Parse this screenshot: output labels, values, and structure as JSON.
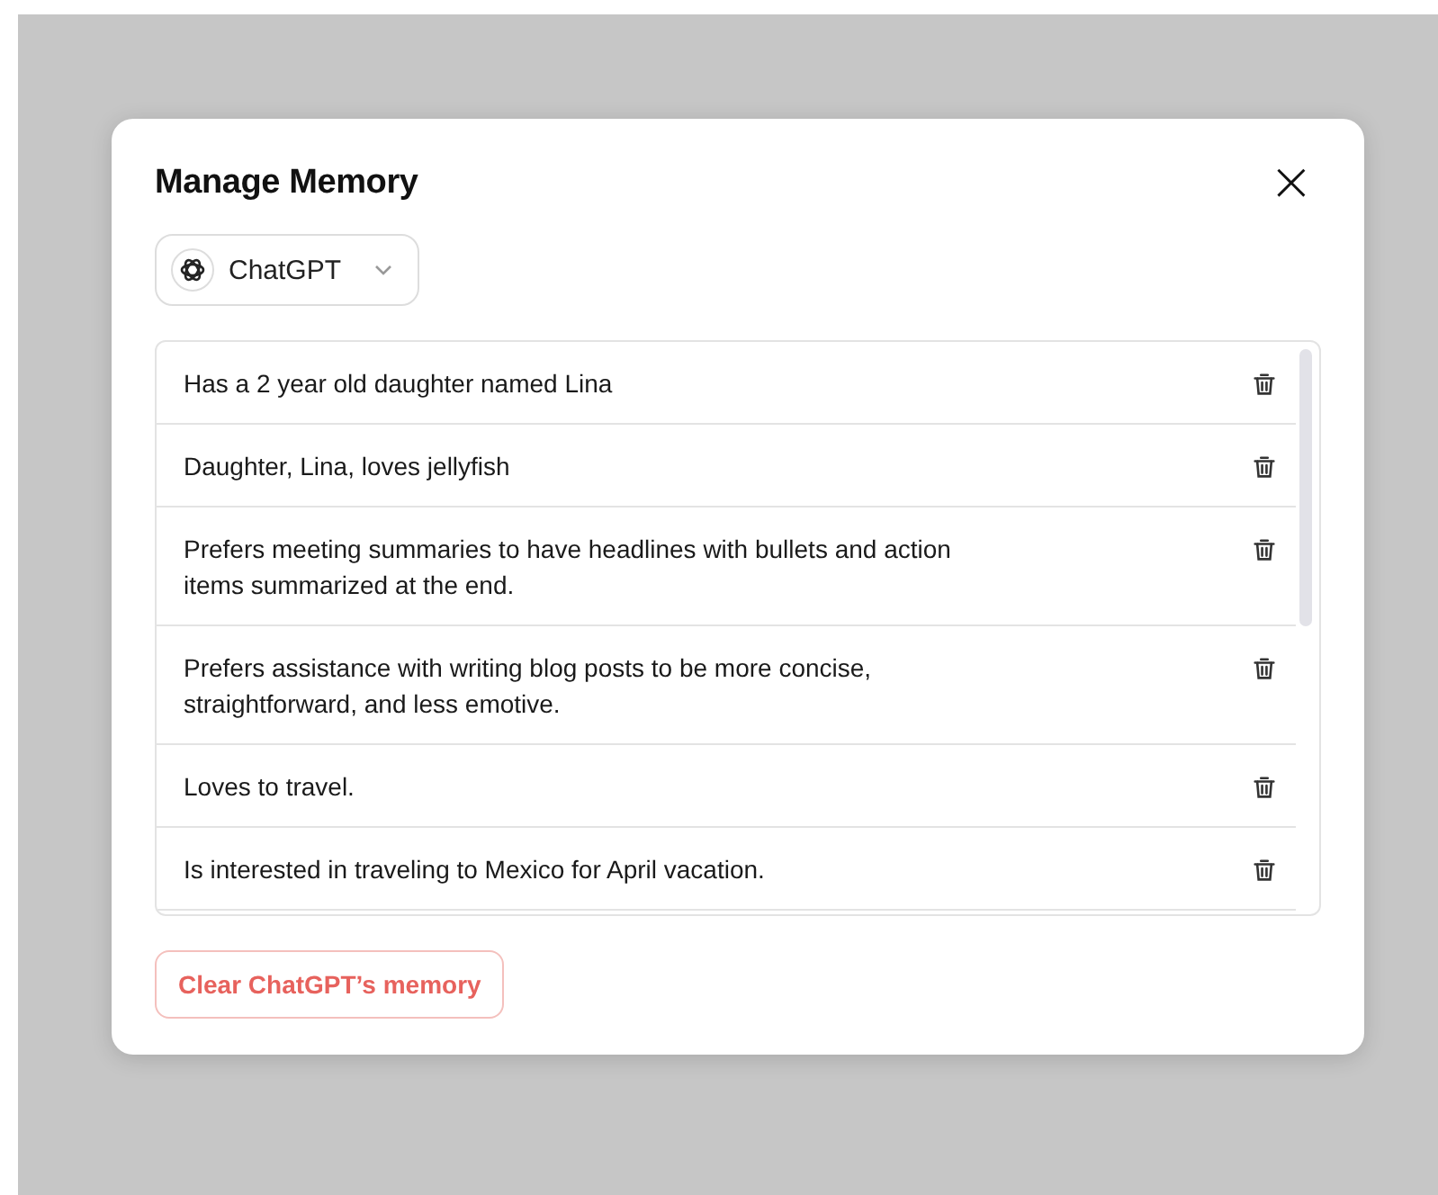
{
  "dialog": {
    "title": "Manage Memory",
    "close": "×"
  },
  "model_selector": {
    "label": "ChatGPT"
  },
  "memories": [
    {
      "text": "Has a 2 year old daughter named Lina"
    },
    {
      "text": "Daughter, Lina, loves jellyfish"
    },
    {
      "text": "Prefers meeting summaries to have headlines with bullets and action items summarized at the end."
    },
    {
      "text": "Prefers assistance with writing blog posts to be more concise, straightforward, and less emotive."
    },
    {
      "text": "Loves to travel."
    },
    {
      "text": "Is interested in traveling to Mexico for April vacation."
    }
  ],
  "clear_button": {
    "label": "Clear ChatGPT’s memory"
  }
}
